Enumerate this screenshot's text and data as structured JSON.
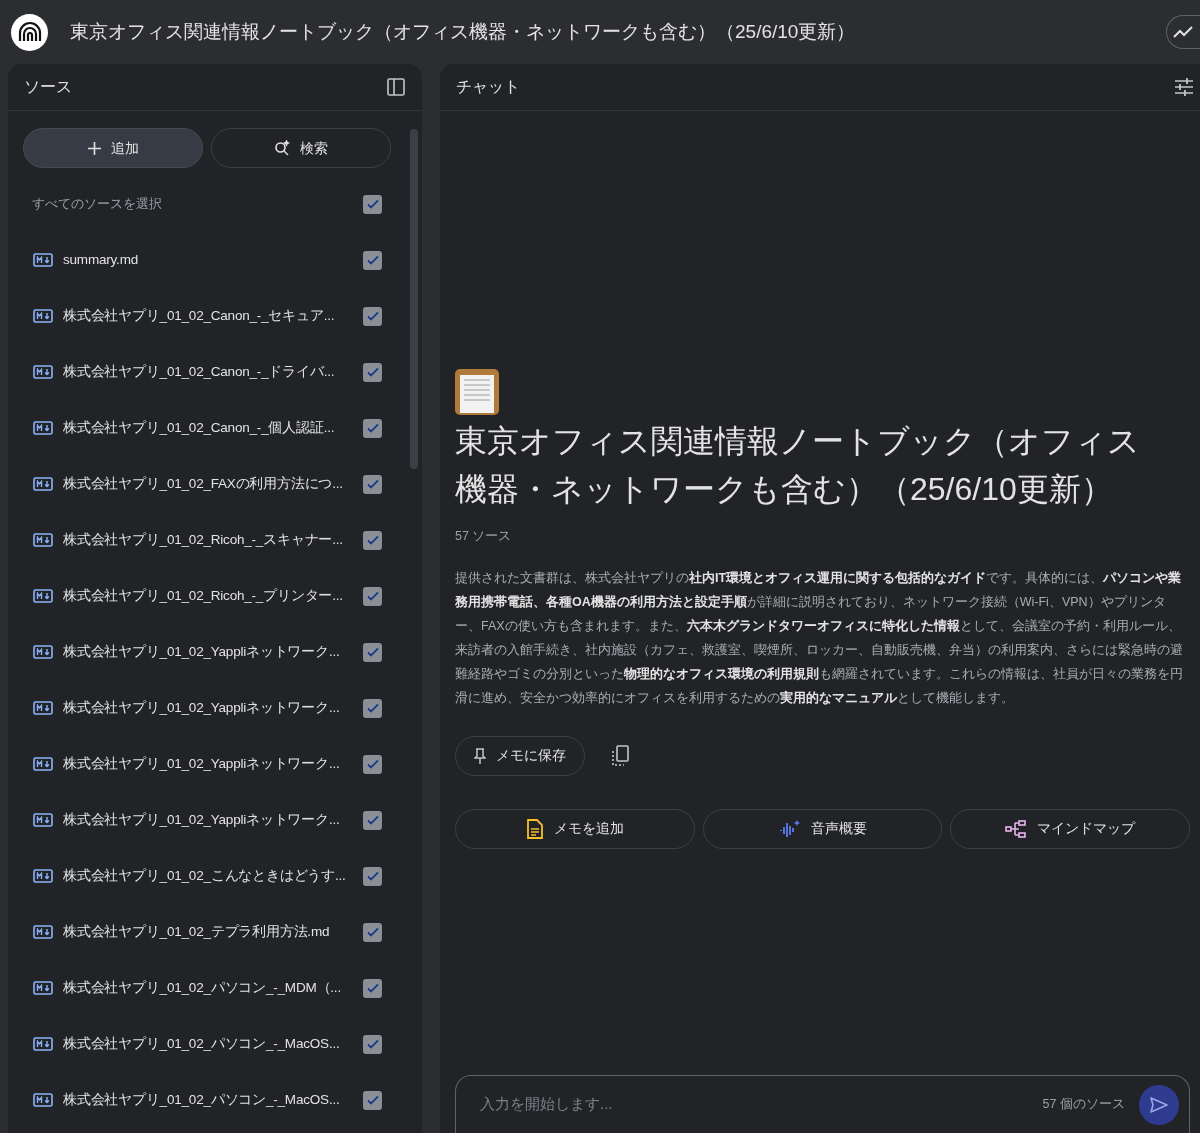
{
  "header": {
    "title": "東京オフィス関連情報ノートブック（オフィス機器・ネットワークも含む）（25/6/10更新）"
  },
  "sources_panel": {
    "title": "ソース",
    "add_button": "追加",
    "search_button": "検索",
    "select_all": {
      "label": "すべてのソースを選択",
      "checked": true
    },
    "items": [
      {
        "name": "summary.md",
        "checked": true
      },
      {
        "name": "株式会社ヤプリ_01_02_Canon_-_セキュア...",
        "checked": true
      },
      {
        "name": "株式会社ヤプリ_01_02_Canon_-_ドライバ...",
        "checked": true
      },
      {
        "name": "株式会社ヤプリ_01_02_Canon_-_個人認証...",
        "checked": true
      },
      {
        "name": "株式会社ヤプリ_01_02_FAXの利用方法につ...",
        "checked": true
      },
      {
        "name": "株式会社ヤプリ_01_02_Ricoh_-_スキャナー...",
        "checked": true
      },
      {
        "name": "株式会社ヤプリ_01_02_Ricoh_-_プリンター...",
        "checked": true
      },
      {
        "name": "株式会社ヤプリ_01_02_Yappliネットワーク...",
        "checked": true
      },
      {
        "name": "株式会社ヤプリ_01_02_Yappliネットワーク...",
        "checked": true
      },
      {
        "name": "株式会社ヤプリ_01_02_Yappliネットワーク...",
        "checked": true
      },
      {
        "name": "株式会社ヤプリ_01_02_Yappliネットワーク...",
        "checked": true
      },
      {
        "name": "株式会社ヤプリ_01_02_こんなときはどうす...",
        "checked": true
      },
      {
        "name": "株式会社ヤプリ_01_02_テプラ利用方法.md",
        "checked": true
      },
      {
        "name": "株式会社ヤプリ_01_02_パソコン_-_MDM（...",
        "checked": true
      },
      {
        "name": "株式会社ヤプリ_01_02_パソコン_-_MacOS...",
        "checked": true
      },
      {
        "name": "株式会社ヤプリ_01_02_パソコン_-_MacOS...",
        "checked": true
      }
    ]
  },
  "chat_panel": {
    "title": "チャット",
    "notebook_title": "東京オフィス関連情報ノートブック（オフィス機器・ネットワークも含む）（25/6/10更新）",
    "source_count": "57 ソース",
    "summary": "提供された文書群は、株式会社ヤプリの**社内IT環境とオフィス運用に関する包括的なガイド**です。具体的には、**パソコンや業務用携帯電話、各種OA機器の利用方法と設定手順**が詳細に説明されており、ネットワーク接続（Wi-Fi、VPN）やプリンター、FAXの使い方も含まれます。また、**六本木グランドタワーオフィスに特化した情報**として、会議室の予約・利用ルール、来訪者の入館手続き、社内施設（カフェ、救護室、喫煙所、ロッカー、自動販売機、弁当）の利用案内、さらには緊急時の避難経路やゴミの分別といった**物理的なオフィス環境の利用規則**も網羅されています。これらの情報は、社員が日々の業務を円滑に進め、安全かつ効率的にオフィスを利用するための**実用的なマニュアル**として機能します。",
    "save_button": "メモに保存",
    "actions": [
      {
        "kind": "note",
        "label": "メモを追加"
      },
      {
        "kind": "audio",
        "label": "音声概要"
      },
      {
        "kind": "mindmap",
        "label": "マインドマップ"
      }
    ],
    "input": {
      "placeholder": "入力を開始します...",
      "source_count": "57 個のソース"
    }
  }
}
